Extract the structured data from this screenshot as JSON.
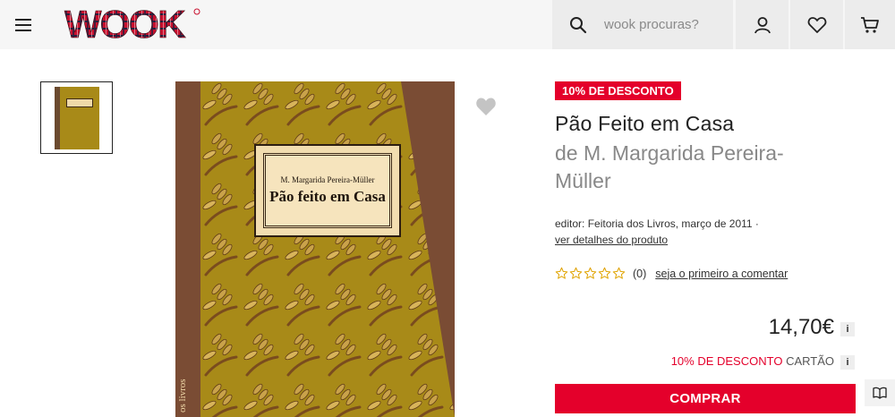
{
  "header": {
    "menu_icon": "hamburger-menu-icon",
    "logo_text": "WOOK",
    "search": {
      "placeholder": "wook procuras?",
      "value": ""
    },
    "icons": [
      "search-icon",
      "user-icon",
      "heart-icon",
      "cart-icon"
    ]
  },
  "gallery": {
    "cover": {
      "author": "M. Margarida Pereira-Müller",
      "title": "Pão feito em Casa",
      "spine_text": "os livros"
    }
  },
  "product": {
    "discount_badge": "10% DE DESCONTO",
    "title": "Pão Feito em Casa",
    "author_prefix": "de",
    "author": "M. Margarida Pereira-Müller",
    "editor_label": "editor:",
    "editor_value": "Feitoria dos Livros, março de 2011 ·",
    "details_link": "ver detalhes do produto",
    "rating": {
      "stars": 0,
      "max": 5,
      "count_text": "(0)"
    },
    "comment_link": "seja o primeiro a comentar",
    "price": "14,70€",
    "info_label": "i",
    "card_discount_red": "10% DE DESCONTO",
    "card_discount_gray": "CARTÃO",
    "buy_label": "COMPRAR"
  },
  "colors": {
    "accent": "#e4002b",
    "header_bg": "#f6f6f6",
    "cover_gold": "#a88a18",
    "cover_brown": "#7a4c34"
  }
}
